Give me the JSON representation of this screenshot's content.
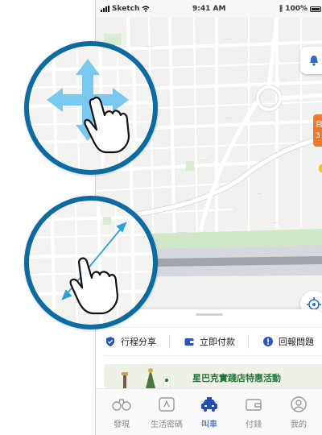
{
  "status_bar": {
    "carrier": "Sketch",
    "time": "9:41 AM",
    "battery": "100%"
  },
  "map": {
    "side_tag": "目 3"
  },
  "actions": [
    {
      "label": "行程分享",
      "icon": "shield-check-icon"
    },
    {
      "label": "立即付款",
      "icon": "wallet-icon"
    },
    {
      "label": "回報問題",
      "icon": "alert-circle-icon"
    }
  ],
  "promo": {
    "title": "星巴克實踐店特惠活動"
  },
  "tabs": [
    {
      "label": "發現",
      "icon": "binoculars-icon"
    },
    {
      "label": "生活密碼",
      "icon": "coupon-icon"
    },
    {
      "label": "叫車",
      "icon": "taxi-icon",
      "active": true
    },
    {
      "label": "付錢",
      "icon": "wallet-icon"
    },
    {
      "label": "我的",
      "icon": "user-icon"
    }
  ],
  "colors": {
    "accent": "#1e4fb0",
    "lens_border": "#0c6ba0",
    "gesture_arrow": "#5bb5e6",
    "orange_tag": "#f07a2b",
    "promo_green": "#1f7a3a"
  },
  "gestures": {
    "top_lens": "pan-gesture-icon",
    "bottom_lens": "pinch-zoom-gesture-icon"
  }
}
